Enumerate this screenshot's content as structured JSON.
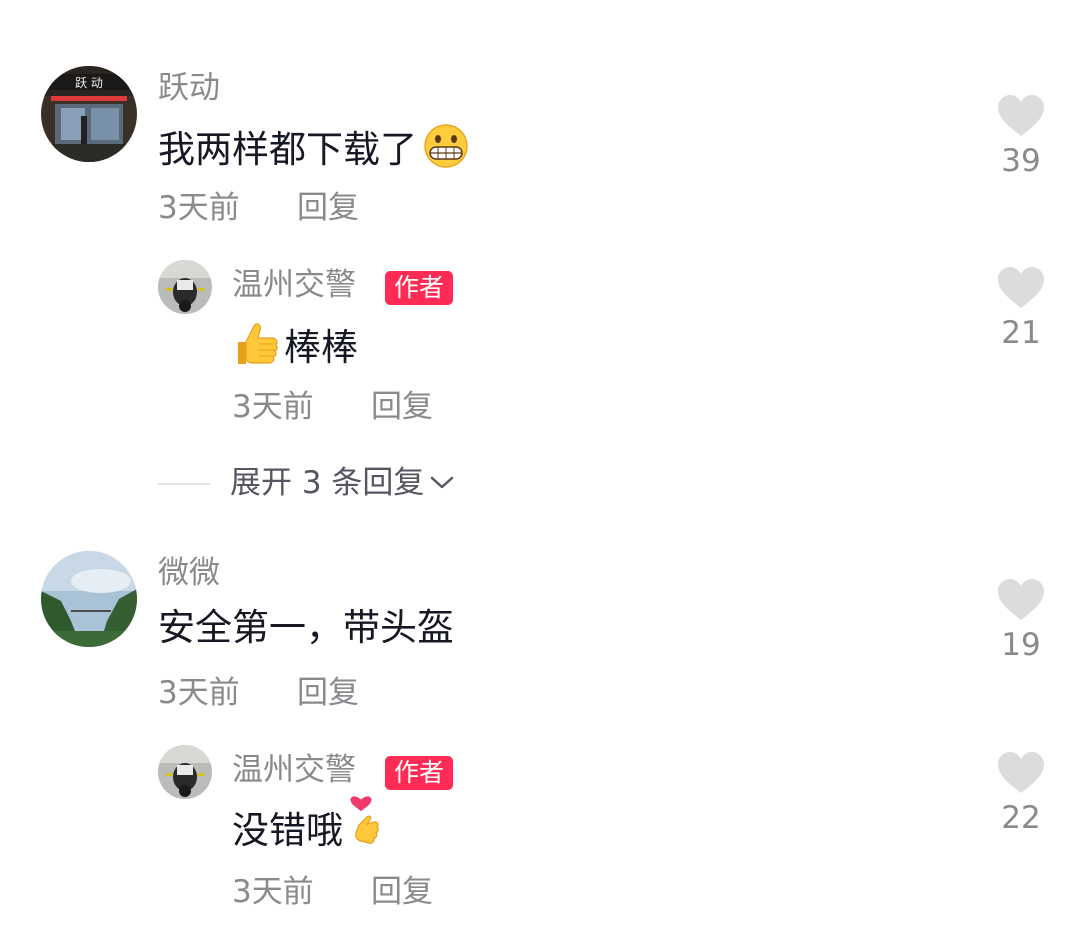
{
  "comments": [
    {
      "username": "跃动",
      "avatar_sign_text": "跃 动",
      "text": "我两样都下载了",
      "emoji": "grinning-face-emoji",
      "time": "3天前",
      "reply_label": "回复",
      "likes": "39",
      "replies": [
        {
          "username": "温州交警",
          "badge": "作者",
          "text": "棒棒",
          "emoji": "thumbs-up-emoji",
          "time": "3天前",
          "reply_label": "回复",
          "likes": "21"
        }
      ],
      "expand_label": "展开 3 条回复"
    },
    {
      "username": "微微",
      "text": "安全第一，带头盔",
      "time": "3天前",
      "reply_label": "回复",
      "likes": "19",
      "replies": [
        {
          "username": "温州交警",
          "badge": "作者",
          "text": "没错哦",
          "emoji": "finger-heart-emoji",
          "time": "3天前",
          "reply_label": "回复",
          "likes": "22"
        }
      ]
    }
  ],
  "colors": {
    "badge": "#fe2c55",
    "secondary_text": "#8a8a8e",
    "primary_text": "#161823",
    "heart": "#dcdcdc"
  }
}
